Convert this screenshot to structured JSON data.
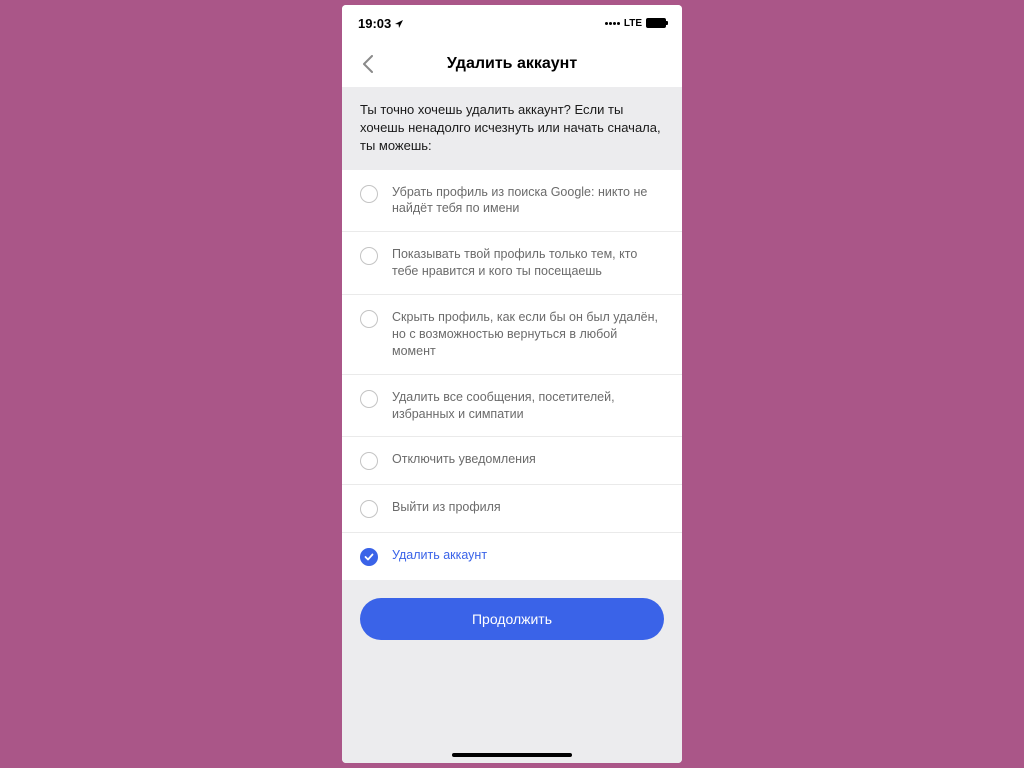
{
  "status": {
    "time": "19:03",
    "network": "LTE"
  },
  "header": {
    "title": "Удалить аккаунт"
  },
  "info": "Ты точно хочешь удалить аккаунт? Если ты хочешь ненадолго исчезнуть или начать сначала, ты можешь:",
  "options": [
    {
      "label": "Убрать профиль из поиска Google: никто не найдёт тебя по имени",
      "checked": false
    },
    {
      "label": "Показывать твой профиль только тем, кто тебе нравится и кого ты посещаешь",
      "checked": false
    },
    {
      "label": "Скрыть профиль, как если бы он был удалён, но с возможностью вернуться в любой момент",
      "checked": false
    },
    {
      "label": "Удалить все сообщения, посетителей, избранных и симпатии",
      "checked": false
    },
    {
      "label": "Отключить уведомления",
      "checked": false
    },
    {
      "label": "Выйти из профиля",
      "checked": false
    },
    {
      "label": "Удалить аккаунт",
      "checked": true
    }
  ],
  "footer": {
    "continue_label": "Продолжить"
  }
}
